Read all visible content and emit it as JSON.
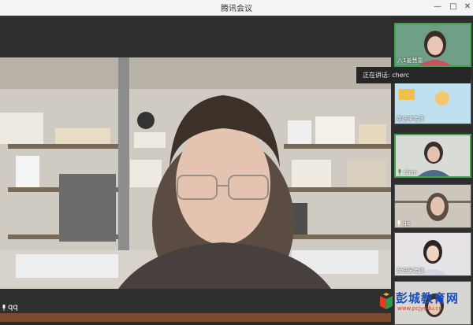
{
  "window": {
    "title": "腾讯会议",
    "minimize_glyph": "—",
    "maximize_glyph": "□",
    "close_glyph": "✕"
  },
  "main_video": {
    "participant_name": "qq",
    "icon": "microphone-icon"
  },
  "speaking_banner": {
    "text": "正在讲话: cherc"
  },
  "participants": [
    {
      "name": "八1姜慧童",
      "active": false
    },
    {
      "name": "英语李老师",
      "active": false
    },
    {
      "name": "chen",
      "active": true
    },
    {
      "name": "qq",
      "active": false
    },
    {
      "name": "英语吴老师",
      "active": false
    },
    {
      "name": "",
      "active": false
    }
  ],
  "watermark": {
    "brand": "彭城教育网",
    "url": "www.pcjyedu.cn"
  },
  "colors": {
    "active_border": "#3fa34d",
    "watermark_blue": "#1d4fb8",
    "watermark_red": "#d03b2a"
  }
}
